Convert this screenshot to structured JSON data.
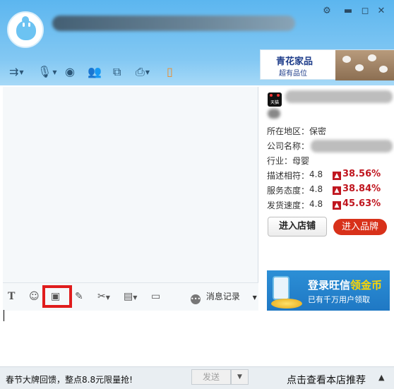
{
  "window": {
    "controls": {
      "settings_icon": "gear-icon",
      "minimize_icon": "minimize-icon",
      "maximize_icon": "maximize-icon",
      "close_icon": "close-icon"
    }
  },
  "toolbar": {
    "items": [
      {
        "icon": "transfer-file-icon",
        "has_menu": true
      },
      {
        "icon": "microphone-icon",
        "has_menu": true
      },
      {
        "icon": "video-icon",
        "has_menu": false
      },
      {
        "icon": "contacts-icon",
        "has_menu": false
      },
      {
        "icon": "share-screen-icon",
        "has_menu": false
      },
      {
        "icon": "remote-assist-icon",
        "has_menu": true
      },
      {
        "icon": "mobile-icon",
        "has_menu": false
      }
    ]
  },
  "ad_banner": {
    "title": "青花家品",
    "subtitle": "超有品位"
  },
  "input_toolbar": {
    "message_record_label": "消息记录"
  },
  "sidebar": {
    "location_label": "所在地区：",
    "location_value": "保密",
    "company_label": "公司名称：",
    "industry_label": "行业：",
    "industry_value": "母婴",
    "ratings": [
      {
        "label": "描述相符：",
        "score": "4.8",
        "percent": "38.56%"
      },
      {
        "label": "服务态度：",
        "score": "4.8",
        "percent": "38.84%"
      },
      {
        "label": "发货速度：",
        "score": "4.8",
        "percent": "45.63%"
      }
    ],
    "enter_store_label": "进入店铺",
    "enter_brand_label": "进入品牌",
    "wangxin_banner": {
      "title_prefix": "登录旺信",
      "title_highlight": "领金币",
      "subtitle": "已有千万用户领取"
    }
  },
  "footer": {
    "promo_text": "春节大牌回馈，整点8.8元限量抢!",
    "send_label": "发送",
    "recommend_label": "点击查看本店推荐"
  },
  "colors": {
    "header": "#5cb6ef",
    "accent_red": "#c0161f",
    "highlight_box": "#e01c1c",
    "brand_button": "#d8311a"
  }
}
